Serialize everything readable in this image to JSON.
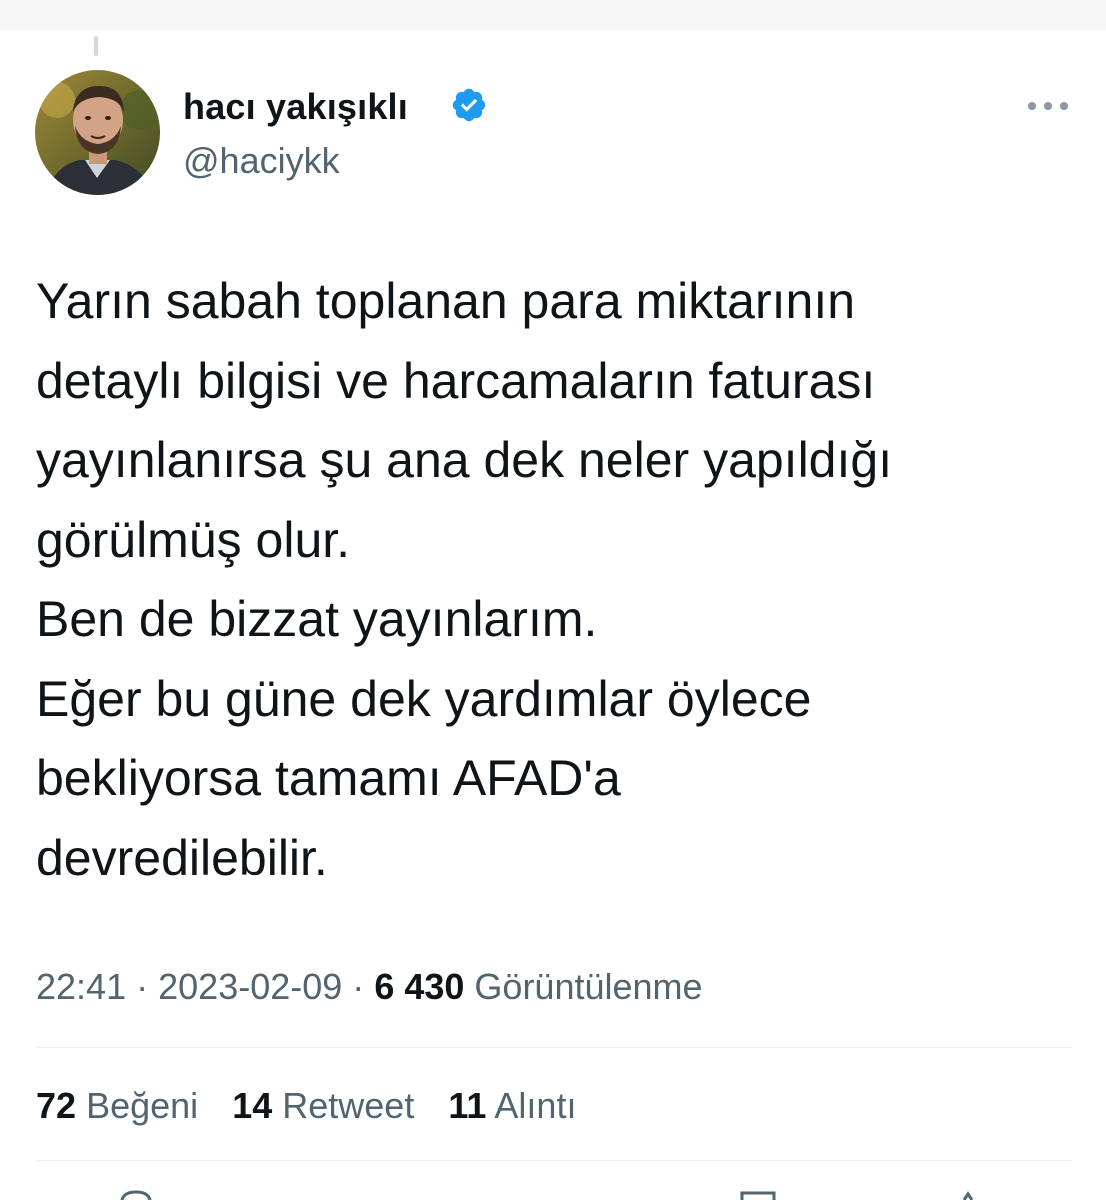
{
  "tweet": {
    "author": {
      "display_name": "hacı yakışıklı",
      "handle": "@haciykk",
      "verified": true,
      "verified_color": "#1d9bf0"
    },
    "text": "Yarın sabah toplanan para miktarının\ndetaylı bilgisi ve harcamaların faturası\nyayınlanırsa şu ana dek neler yapıldığı\ngörülmüş olur.\nBen de bizzat yayınlarım.\nEğer bu güne dek yardımlar öylece\nbekliyorsa tamamı AFAD'a\ndevredilebilir.",
    "time": "22:41",
    "separator": "·",
    "date": "2023-02-09",
    "views_count": "6 430",
    "views_label": "Görüntülenme"
  },
  "stats": {
    "likes_count": "72",
    "likes_label": "Beğeni",
    "retweets_count": "14",
    "retweets_label": "Retweet",
    "quotes_count": "11",
    "quotes_label": "Alıntı"
  },
  "icons": {
    "more": "more-options-icon",
    "verified": "verified-badge-icon",
    "avatar": "profile-avatar"
  },
  "colors": {
    "text": "#0f1419",
    "secondary": "#536471",
    "divider": "#eff3f4",
    "accent": "#1d9bf0"
  }
}
